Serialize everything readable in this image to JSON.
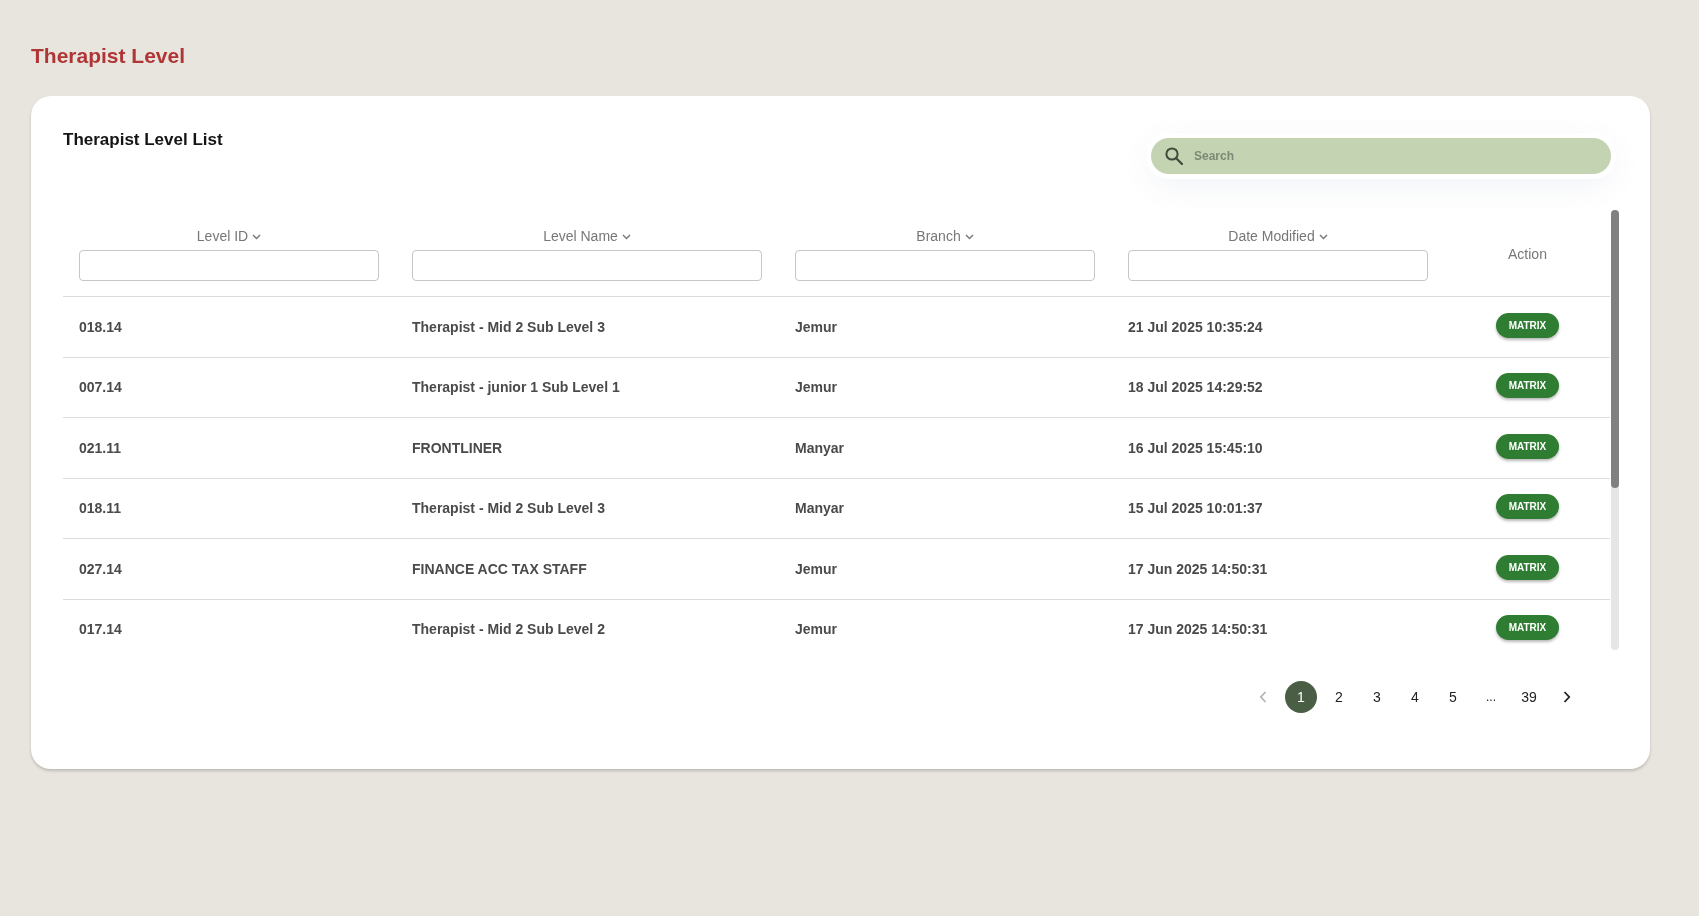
{
  "page_title": "Therapist Level",
  "card": {
    "title": "Therapist Level List",
    "search": {
      "placeholder": "Search"
    },
    "table": {
      "columns": [
        {
          "label": "Level ID",
          "kind": "filter"
        },
        {
          "label": "Level Name",
          "kind": "filter"
        },
        {
          "label": "Branch",
          "kind": "filter"
        },
        {
          "label": "Date Modified",
          "kind": "filter"
        },
        {
          "label": "Action",
          "kind": "plain"
        }
      ],
      "rows": [
        {
          "level_id": "018.14",
          "level_name": "Therapist - Mid 2 Sub Level 3",
          "branch": "Jemur",
          "date_modified": "21 Jul 2025 10:35:24",
          "action": "MATRIX"
        },
        {
          "level_id": "007.14",
          "level_name": "Therapist - junior 1 Sub Level 1",
          "branch": "Jemur",
          "date_modified": "18 Jul 2025 14:29:52",
          "action": "MATRIX"
        },
        {
          "level_id": "021.11",
          "level_name": "FRONTLINER",
          "branch": "Manyar",
          "date_modified": "16 Jul 2025 15:45:10",
          "action": "MATRIX"
        },
        {
          "level_id": "018.11",
          "level_name": "Therapist - Mid 2 Sub Level 3",
          "branch": "Manyar",
          "date_modified": "15 Jul 2025 10:01:37",
          "action": "MATRIX"
        },
        {
          "level_id": "027.14",
          "level_name": "FINANCE ACC TAX STAFF",
          "branch": "Jemur",
          "date_modified": "17 Jun 2025 14:50:31",
          "action": "MATRIX"
        },
        {
          "level_id": "017.14",
          "level_name": "Therapist - Mid 2 Sub Level 2",
          "branch": "Jemur",
          "date_modified": "17 Jun 2025 14:50:31",
          "action": "MATRIX"
        }
      ]
    },
    "pagination": {
      "prev": {
        "disabled": true
      },
      "pages": [
        {
          "label": "1",
          "kind": "page",
          "selected": true
        },
        {
          "label": "2",
          "kind": "page",
          "selected": false
        },
        {
          "label": "3",
          "kind": "page",
          "selected": false
        },
        {
          "label": "4",
          "kind": "page",
          "selected": false
        },
        {
          "label": "5",
          "kind": "page",
          "selected": false
        },
        {
          "label": "...",
          "kind": "ellipsis",
          "selected": false
        },
        {
          "label": "39",
          "kind": "page",
          "selected": false
        }
      ],
      "next": {
        "disabled": false
      }
    }
  }
}
